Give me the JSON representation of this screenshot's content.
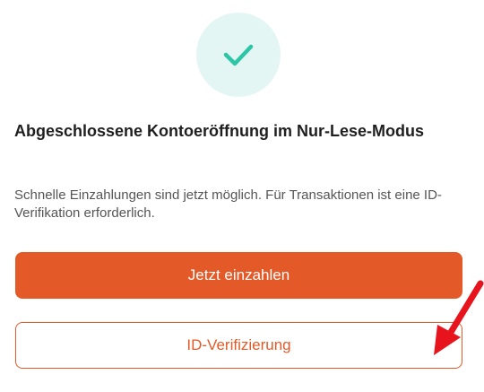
{
  "colors": {
    "accent": "#e35a28",
    "success": "#2cc6a7",
    "success_bg": "#e4f6f4",
    "annotation": "#e8141d"
  },
  "success_icon": "checkmark-icon",
  "dialog": {
    "title": "Abgeschlossene Kontoeröffnung im Nur-Lese-Modus",
    "description": "Schnelle Einzahlungen sind jetzt möglich. Für Transaktionen ist eine ID-Verifikation erforderlich."
  },
  "buttons": {
    "deposit_label": "Jetzt einzahlen",
    "verify_label": "ID-Verifizierung"
  },
  "annotation": {
    "icon": "red-arrow-icon"
  }
}
